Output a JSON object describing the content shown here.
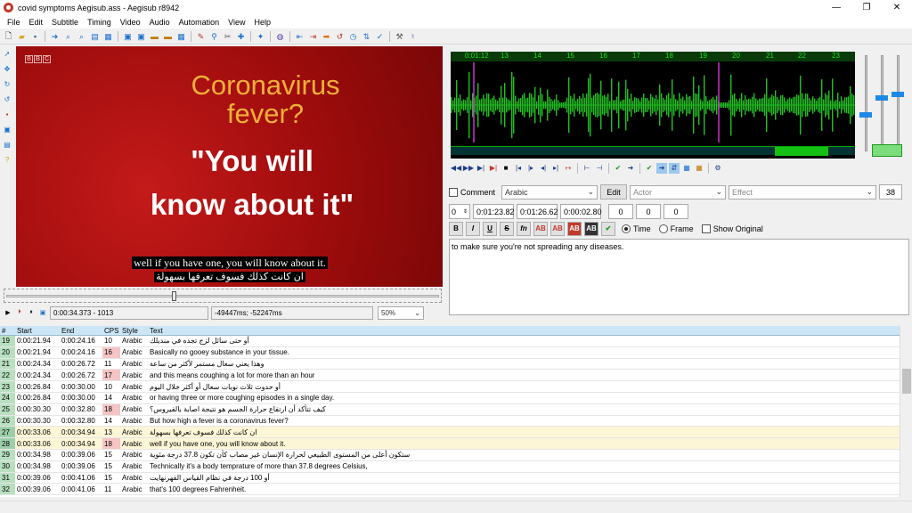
{
  "window": {
    "title": "covid symptoms Aegisub.ass - Aegisub r8942",
    "minimize": "—",
    "maximize": "❐",
    "close": "✕"
  },
  "menu": [
    "File",
    "Edit",
    "Subtitle",
    "Timing",
    "Video",
    "Audio",
    "Automation",
    "View",
    "Help"
  ],
  "video": {
    "logo": [
      "B",
      "B",
      "C"
    ],
    "headline_1": "Coronavirus",
    "headline_2": "fever?",
    "quote_1": "\"You will",
    "quote_2": "know about it\"",
    "subtitle_en": "well if you have one, you will know about it.",
    "subtitle_ar": "ان كانت كذلك فسوف تعرفها بسهولة"
  },
  "video_controls": {
    "time": "0:00:34.373 - 1013",
    "offset": "-49447ms; -52247ms",
    "zoom": "50%"
  },
  "audio": {
    "ruler": [
      "0:01:12",
      "13",
      "14",
      "15",
      "16",
      "17",
      "18",
      "19",
      "20",
      "21",
      "22",
      "23"
    ]
  },
  "editor": {
    "comment_label": "Comment",
    "style": "Arabic",
    "edit_label": "Edit",
    "actor_placeholder": "Actor",
    "effect_placeholder": "Effect",
    "char_count": "38",
    "layer": "0",
    "start": "0:01:23.82",
    "end": "0:01:26.62",
    "duration": "0:00:02.80",
    "margin_l": "0",
    "margin_r": "0",
    "margin_v": "0",
    "format_buttons": [
      "B",
      "I",
      "U",
      "S",
      "fn",
      "AB",
      "AB",
      "AB",
      "AB"
    ],
    "time_label": "Time",
    "frame_label": "Frame",
    "show_original_label": "Show Original",
    "text": "to make sure you're not spreading any diseases."
  },
  "grid": {
    "headers": [
      "#",
      "Start",
      "End",
      "CPS",
      "Style",
      "Text"
    ],
    "rows": [
      {
        "n": "19",
        "start": "0:00:21.94",
        "end": "0:00:24.16",
        "cps": "10",
        "style": "Arabic",
        "text": "أو حتى سائل لزج تجده في منديلك",
        "hi": false,
        "sel": false
      },
      {
        "n": "20",
        "start": "0:00:21.94",
        "end": "0:00:24.16",
        "cps": "16",
        "style": "Arabic",
        "text": "Basically no gooey substance in your tissue.",
        "hi": true,
        "sel": false
      },
      {
        "n": "21",
        "start": "0:00:24.34",
        "end": "0:00:26.72",
        "cps": "11",
        "style": "Arabic",
        "text": "وهذا يعني سعال مستمر لأكثر من ساعة",
        "hi": false,
        "sel": false
      },
      {
        "n": "22",
        "start": "0:00:24.34",
        "end": "0:00:26.72",
        "cps": "17",
        "style": "Arabic",
        "text": "and this means coughing a lot for more than an hour",
        "hi": true,
        "sel": false
      },
      {
        "n": "23",
        "start": "0:00:26.84",
        "end": "0:00:30.00",
        "cps": "10",
        "style": "Arabic",
        "text": "أو حدوث ثلاث نوبات سعال أو أكثر خلال اليوم",
        "hi": false,
        "sel": false
      },
      {
        "n": "24",
        "start": "0:00:26.84",
        "end": "0:00:30.00",
        "cps": "14",
        "style": "Arabic",
        "text": "or having three or more coughing episodes in a single day.",
        "hi": false,
        "sel": false
      },
      {
        "n": "25",
        "start": "0:00:30.30",
        "end": "0:00:32.80",
        "cps": "18",
        "style": "Arabic",
        "text": "كيف تتأكد أن ارتفاع حرارة الجسم هو نتيجة اصابة بالفيروس؟",
        "hi": true,
        "sel": false
      },
      {
        "n": "26",
        "start": "0:00:30.30",
        "end": "0:00:32.80",
        "cps": "14",
        "style": "Arabic",
        "text": "But how high a fever is a coronavirus fever?",
        "hi": false,
        "sel": false
      },
      {
        "n": "27",
        "start": "0:00:33.06",
        "end": "0:00:34.94",
        "cps": "13",
        "style": "Arabic",
        "text": "ان كانت كذلك فسوف تعرفها بسهولة",
        "hi": false,
        "sel": true
      },
      {
        "n": "28",
        "start": "0:00:33.06",
        "end": "0:00:34.94",
        "cps": "18",
        "style": "Arabic",
        "text": "well if you have one, you will know about it.",
        "hi": true,
        "sel": true
      },
      {
        "n": "29",
        "start": "0:00:34.98",
        "end": "0:00:39.06",
        "cps": "15",
        "style": "Arabic",
        "text": "ستكون أعلى من المستوى الطبيعي لحرارة الإنسان غير مصاب كأن تكون 37.8 درجة مئوية",
        "hi": false,
        "sel": false
      },
      {
        "n": "30",
        "start": "0:00:34.98",
        "end": "0:00:39.06",
        "cps": "15",
        "style": "Arabic",
        "text": "Technically it's a body temprature of more than 37.8 degrees Celsius,",
        "hi": false,
        "sel": false
      },
      {
        "n": "31",
        "start": "0:00:39.06",
        "end": "0:00:41.06",
        "cps": "15",
        "style": "Arabic",
        "text": "أو 100 درجة في نظام القياس الفهرنهايت",
        "hi": false,
        "sel": false
      },
      {
        "n": "32",
        "start": "0:00:39.06",
        "end": "0:00:41.06",
        "cps": "11",
        "style": "Arabic",
        "text": "that's 100 degrees Fahrenheit.",
        "hi": false,
        "sel": false
      }
    ]
  }
}
